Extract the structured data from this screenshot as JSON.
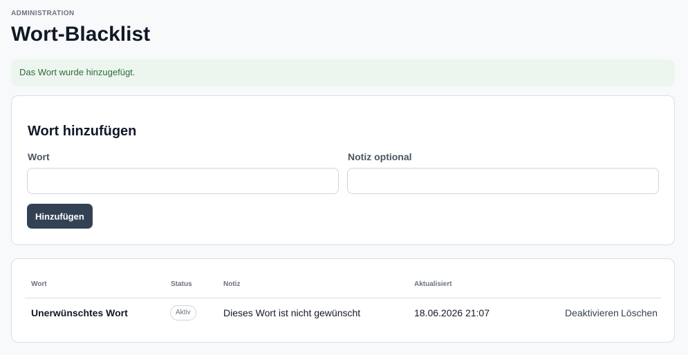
{
  "header": {
    "eyebrow": "ADMINISTRATION",
    "title": "Wort-Blacklist"
  },
  "alert": {
    "message": "Das Wort wurde hinzugefügt."
  },
  "form": {
    "title": "Wort hinzufügen",
    "word_label": "Wort",
    "word_value": "",
    "note_label": "Notiz optional",
    "note_value": "",
    "submit_label": "Hinzufügen"
  },
  "table": {
    "columns": [
      "Wort",
      "Status",
      "Notiz",
      "Aktualisiert"
    ],
    "rows": [
      {
        "word": "Unerwünschtes Wort",
        "status": "Aktiv",
        "note": "Dieses Wort ist nicht gewünscht",
        "updated": "18.06.2026 21:07",
        "action_deactivate": "Deaktivieren",
        "action_delete": "Löschen"
      }
    ]
  }
}
